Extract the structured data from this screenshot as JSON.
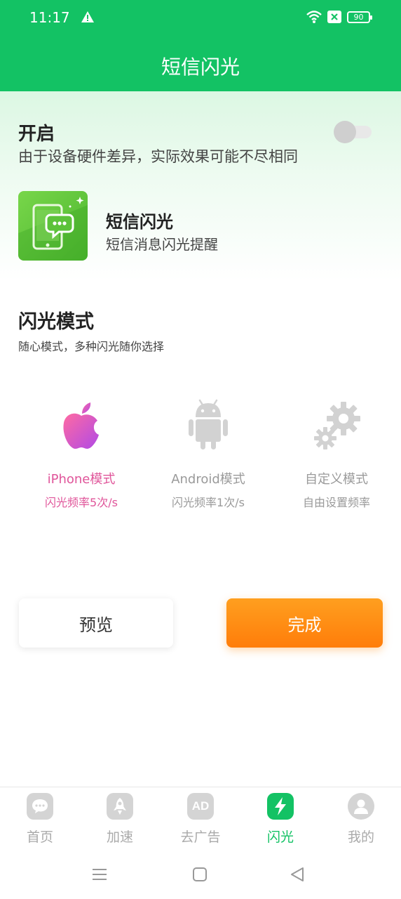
{
  "status": {
    "time": "11:17",
    "battery": "90"
  },
  "header": {
    "title": "短信闪光"
  },
  "enable": {
    "title": "开启",
    "description": "由于设备硬件差异，实际效果可能不尽相同",
    "toggle_on": false
  },
  "feature": {
    "name": "短信闪光",
    "description": "短信消息闪光提醒"
  },
  "flash_mode": {
    "title": "闪光模式",
    "description": "随心模式，多种闪光随你选择",
    "modes": [
      {
        "label": "iPhone模式",
        "sub": "闪光频率5次/s",
        "icon": "apple-icon",
        "selected": true
      },
      {
        "label": "Android模式",
        "sub": "闪光频率1次/s",
        "icon": "android-icon",
        "selected": false
      },
      {
        "label": "自定义模式",
        "sub": "自由设置频率",
        "icon": "gears-icon",
        "selected": false
      }
    ]
  },
  "buttons": {
    "preview": "预览",
    "done": "完成"
  },
  "tabs": [
    {
      "label": "首页",
      "icon": "chat-icon",
      "active": false
    },
    {
      "label": "加速",
      "icon": "rocket-icon",
      "active": false
    },
    {
      "label": "去广告",
      "icon": "ad-icon",
      "active": false
    },
    {
      "label": "闪光",
      "icon": "lightning-icon",
      "active": true
    },
    {
      "label": "我的",
      "icon": "user-icon",
      "active": false
    }
  ],
  "tab_ad_icon_text": "AD",
  "colors": {
    "brand_green": "#13c264",
    "accent_orange": "#ff8c14",
    "iphone_pink": "#e0559a"
  }
}
